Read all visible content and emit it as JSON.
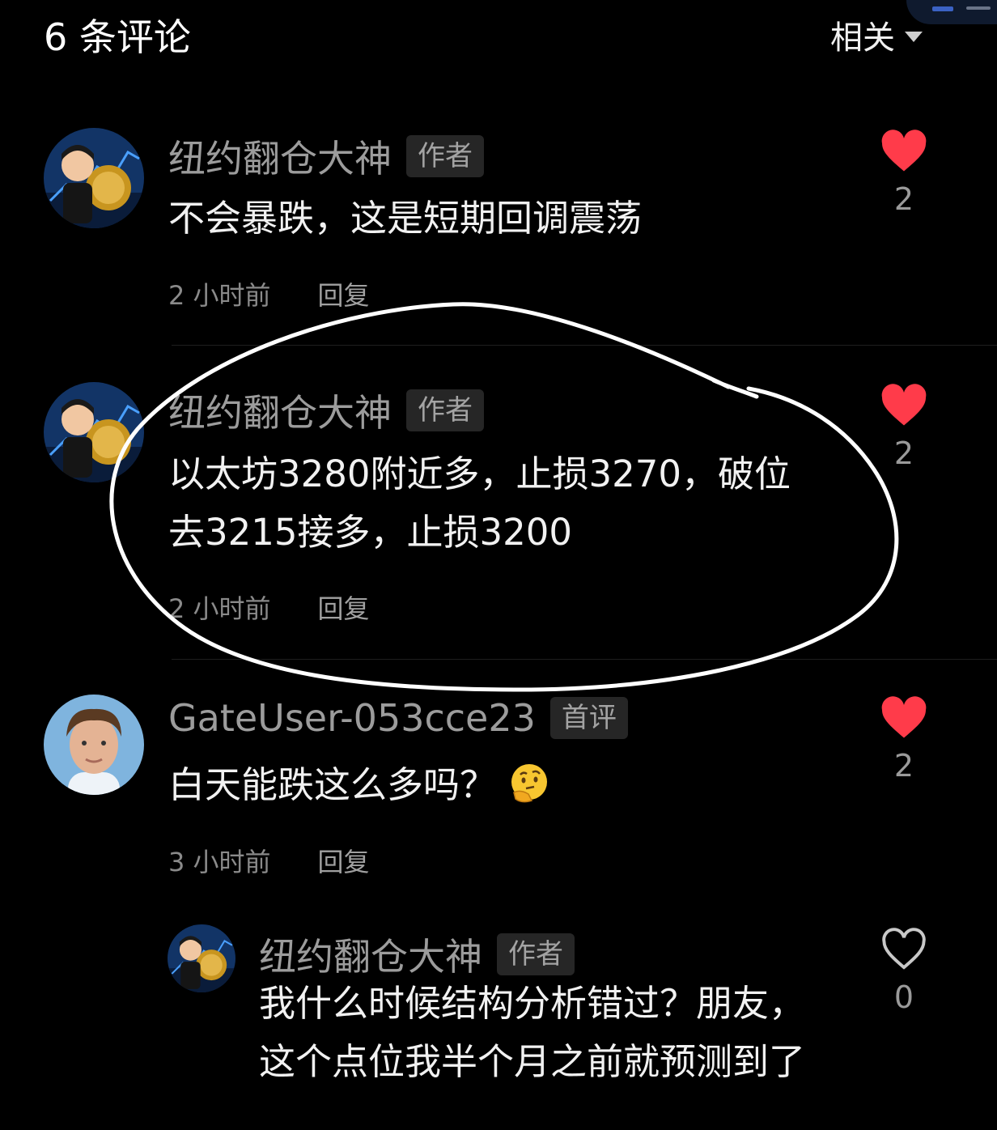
{
  "header": {
    "title": "6 条评论",
    "sort_label": "相关"
  },
  "comments": [
    {
      "name": "纽约翻仓大神",
      "badge": "作者",
      "text_lines": [
        "不会暴跌，这是短期回调震荡"
      ],
      "time": "2 小时前",
      "reply": "回复",
      "likes": "2",
      "liked": true
    },
    {
      "name": "纽约翻仓大神",
      "badge": "作者",
      "text_lines": [
        "以太坊3280附近多，止损3270，破位",
        "去3215接多，止损3200"
      ],
      "time": "2 小时前",
      "reply": "回复",
      "likes": "2",
      "liked": true
    },
    {
      "name": "GateUser-053cce23",
      "badge": "首评",
      "text_lines": [
        "白天能跌这么多吗？"
      ],
      "time": "3 小时前",
      "reply": "回复",
      "likes": "2",
      "liked": true
    },
    {
      "name": "纽约翻仓大神",
      "badge": "作者",
      "text_lines": [
        "我什么时候结构分析错过？朋友，",
        "这个点位我半个月之前就预测到了"
      ],
      "time": "",
      "reply": "",
      "likes": "0",
      "liked": false
    }
  ],
  "colors": {
    "like_red": "#ff3b4a",
    "background": "#000000"
  },
  "icons": {
    "like": "heart-filled-icon",
    "unliked": "heart-outline-icon",
    "emoji": "thinking-face-emoji",
    "sort": "caret-down-icon"
  }
}
